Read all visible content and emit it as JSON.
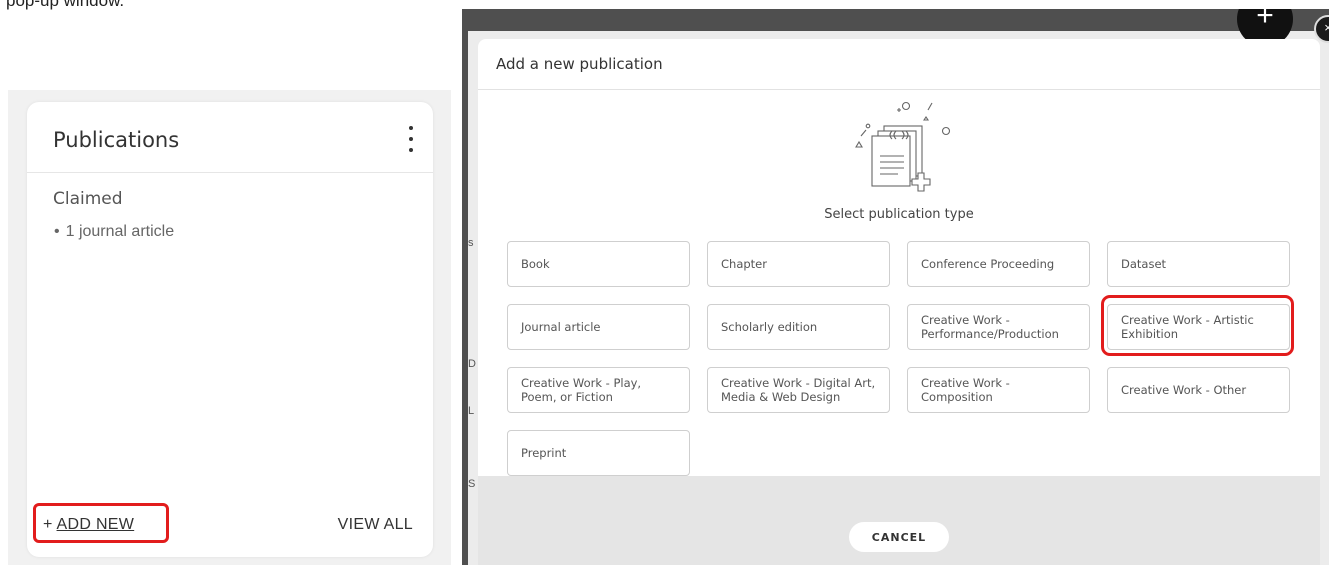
{
  "instruction_fragment": "pop-up window.",
  "publications_card": {
    "title": "Publications",
    "claimed_label": "Claimed",
    "items": [
      {
        "bullet": "•",
        "label": "1 journal article"
      }
    ],
    "add_new_prefix": "+",
    "add_new_label": "ADD NEW",
    "view_all_label": "VIEW ALL"
  },
  "backdrop": {
    "fab_icon": "plus-icon",
    "fab_symbol": "+",
    "close_symbol": "×",
    "edge_letters": [
      "s",
      "D",
      "L",
      "S"
    ]
  },
  "modal": {
    "title": "Add a new publication",
    "illustration_icon": "document-quote-plus-icon",
    "select_label": "Select publication type",
    "types": [
      "Book",
      "Chapter",
      "Conference Proceeding",
      "Dataset",
      "Journal article",
      "Scholarly edition",
      "Creative Work - Performance/Production",
      "Creative Work - Artistic Exhibition",
      "Creative Work - Play, Poem, or Fiction",
      "Creative Work - Digital Art, Media & Web Design",
      "Creative Work - Composition",
      "Creative Work - Other",
      "Preprint"
    ],
    "cancel_label": "CANCEL"
  },
  "colors": {
    "highlight": "#e21c1c",
    "backdrop": "#4f4f4f",
    "footer": "#e5e5e5"
  }
}
